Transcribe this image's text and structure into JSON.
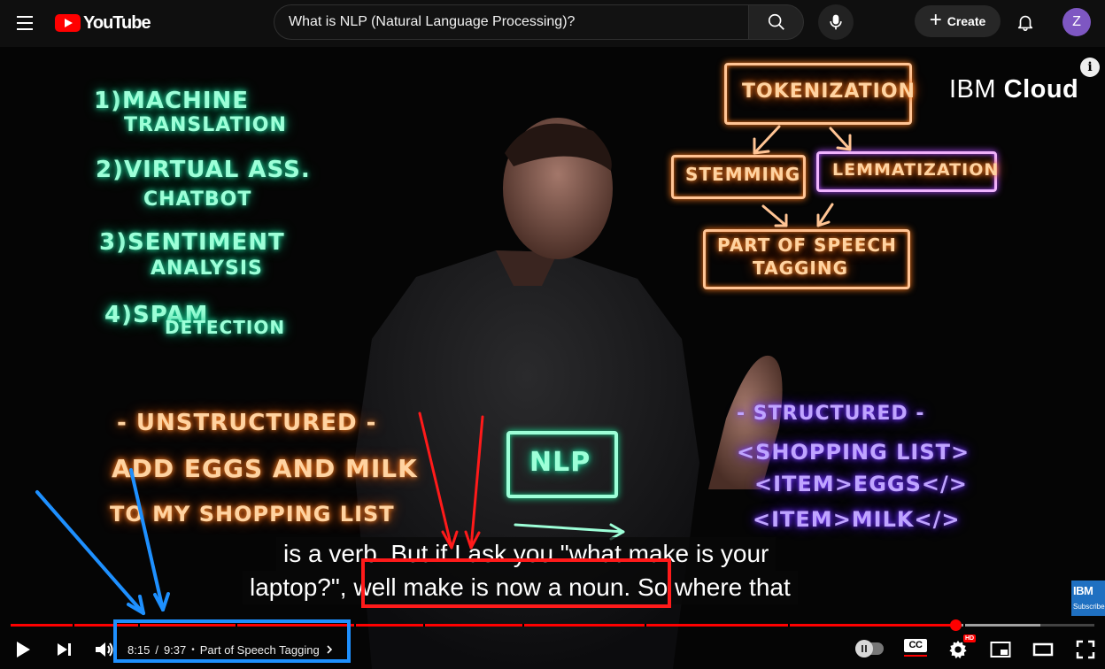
{
  "masthead": {
    "logo_text": "YouTube",
    "search_value": "What is NLP (Natural Language Processing)?",
    "create_label": "Create",
    "avatar_initial": "Z"
  },
  "video": {
    "brand_light": "IBM ",
    "brand_bold": "Cloud",
    "info_label": "i",
    "board": {
      "left_list": [
        {
          "num": "1)",
          "lines": [
            "MACHINE",
            "TRANSLATION"
          ]
        },
        {
          "num": "2)",
          "lines": [
            "VIRTUAL ASS.",
            "CHATBOT"
          ]
        },
        {
          "num": "3)",
          "lines": [
            "SENTIMENT",
            "ANALYSIS"
          ]
        },
        {
          "num": "4)",
          "lines": [
            "SPAM",
            "DETECTION"
          ]
        }
      ],
      "unstructured_title": "- UNSTRUCTURED -",
      "unstructured_lines": [
        "ADD EGGS AND MILK",
        "TO MY SHOPPING LIST"
      ],
      "center_label": "NLP",
      "flow": {
        "tokenization": "TOKENIZATION",
        "stemming": "STEMMING",
        "lemmatization": "LEMMATIZATION",
        "pos": [
          "PART OF SPEECH",
          "TAGGING"
        ]
      },
      "structured_title": "- STRUCTURED -",
      "structured_lines": [
        "<SHOPPING LIST>",
        "<ITEM>EGGS</>",
        "<ITEM>MILK</>"
      ]
    },
    "captions": {
      "line1": "is a verb. But if I ask you \"what make is your",
      "line2_pre": "laptop?\", ",
      "line2_highlight": "well make is now a noun",
      "line2_post": ". So where that"
    },
    "watermark": {
      "logo": "IBM",
      "sub": "Subscribe"
    }
  },
  "player": {
    "progress_fraction": 0.8717,
    "buffered_fraction": 0.95,
    "current_time": "8:15",
    "duration": "9:37",
    "separator": "•",
    "chapter_title": "Part of Speech Tagging",
    "cc_label": "CC",
    "hd_label": "HD"
  },
  "colors": {
    "youtube_red": "#ff0000",
    "annotation_red": "#ff1a1a",
    "annotation_blue": "#1e90ff",
    "chalk_green": "#9dffd8",
    "chalk_orange": "#ffd3a1",
    "chalk_purple": "#bfa4ff"
  }
}
